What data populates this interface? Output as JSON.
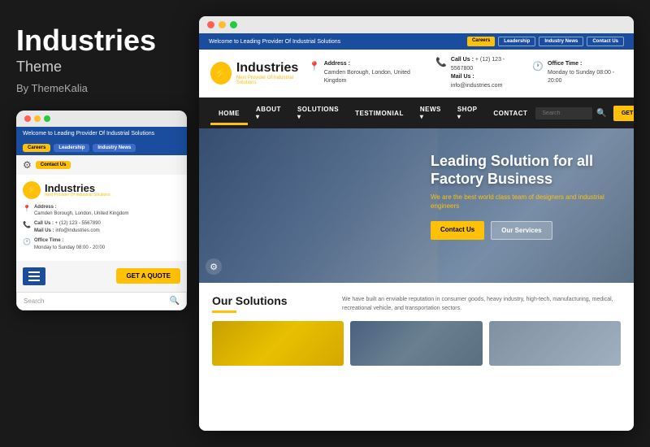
{
  "left": {
    "title": "Industries",
    "subtitle": "Theme",
    "author": "By ThemeKalia"
  },
  "mobile": {
    "topbar_text": "Welcome to Leading Provider Of Industrial Solutions",
    "pills": [
      "Careers",
      "Leadership",
      "Industry News"
    ],
    "contact_pill": "Contact Us",
    "logo_text": "Industries",
    "logo_sub": "Next Provider Of Industrial Solutions",
    "address_label": "Address :",
    "address_value": "Camden Borough, London, United Kingdom",
    "call_label": "Call Us :",
    "call_value": "+ (12) 123 - 5567890",
    "mail_label": "Mail Us :",
    "mail_value": "info@industries.com",
    "office_label": "Office Time :",
    "office_value": "Monday to Sunday 08:00 - 20:00",
    "get_quote": "GET A QUOTE",
    "search_placeholder": "Search"
  },
  "desktop": {
    "topbar_text": "Welcome to Leading Provider Of Industrial Solutions",
    "topbar_pills": [
      "Careers",
      "Leadership",
      "Industry News",
      "Contact Us"
    ],
    "logo_text": "Industries",
    "logo_sub": "Next Provider Of Industrial Solutions",
    "address_label": "Address :",
    "address_value": "Camden Borough, London, United Kingdom",
    "call_label": "Call Us :",
    "call_value": "+ (12) 123 - 5567800",
    "mail_label": "Mail Us :",
    "mail_value": "info@industries.com",
    "office_label": "Office Time :",
    "office_value": "Monday to Sunday 08:00 - 20:00",
    "nav_items": [
      "HOME",
      "ABOUT",
      "SOLUTIONS",
      "TESTIMONIAL",
      "NEWS",
      "SHOP",
      "CONTACT"
    ],
    "search_placeholder": "Search",
    "get_quote": "GET A QUOTE",
    "hero_title": "Leading Solution for all Factory Business",
    "hero_subtitle": "We are the best world class team of designers and industrial engineers",
    "hero_btn1": "Contact Us",
    "hero_btn2": "Our Services",
    "solutions_title": "Our Solutions",
    "solutions_text": "We have built an enviable reputation in consumer goods, heavy industry, high-tech, manufacturing, medical, recreational vehicle, and transportation sectors."
  }
}
